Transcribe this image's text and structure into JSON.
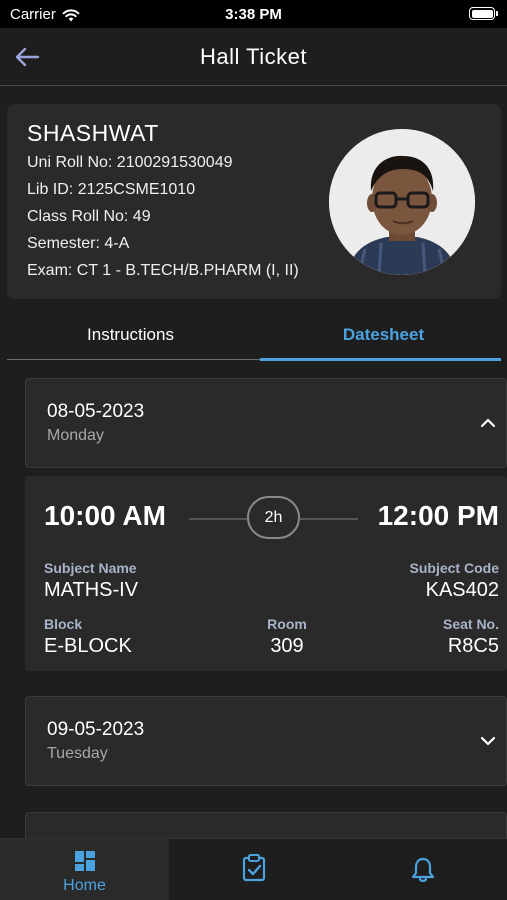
{
  "status_bar": {
    "carrier": "Carrier",
    "time": "3:38 PM"
  },
  "app_bar": {
    "title": "Hall Ticket"
  },
  "profile": {
    "name": "SHASHWAT",
    "uni_roll": "Uni Roll No: 2100291530049",
    "lib_id": "Lib ID: 2125CSME1010",
    "class_roll": "Class Roll No: 49",
    "semester": "Semester: 4-A",
    "exam": "Exam: CT 1 - B.TECH/B.PHARM (I, II)"
  },
  "tabs": [
    {
      "label": "Instructions",
      "active": false
    },
    {
      "label": "Datesheet",
      "active": true
    }
  ],
  "datesheet": [
    {
      "date": "08-05-2023",
      "day": "Monday",
      "expanded": true,
      "start_time": "10:00 AM",
      "end_time": "12:00 PM",
      "duration": "2h",
      "subject_name_label": "Subject Name",
      "subject_name": "MATHS-IV",
      "subject_code_label": "Subject Code",
      "subject_code": "KAS402",
      "block_label": "Block",
      "block": "E-BLOCK",
      "room_label": "Room",
      "room": "309",
      "seat_label": "Seat No.",
      "seat": "R8C5"
    },
    {
      "date": "09-05-2023",
      "day": "Tuesday",
      "expanded": false
    }
  ],
  "bottom_nav": {
    "items": [
      {
        "label": "Home",
        "icon": "grid-icon",
        "active": true
      },
      {
        "icon": "clipboard-check-icon",
        "active": false
      },
      {
        "icon": "bell-icon",
        "active": false
      }
    ]
  },
  "colors": {
    "accent": "#4aa3df",
    "background": "#1e1e1e",
    "card": "#2a2a2a"
  }
}
